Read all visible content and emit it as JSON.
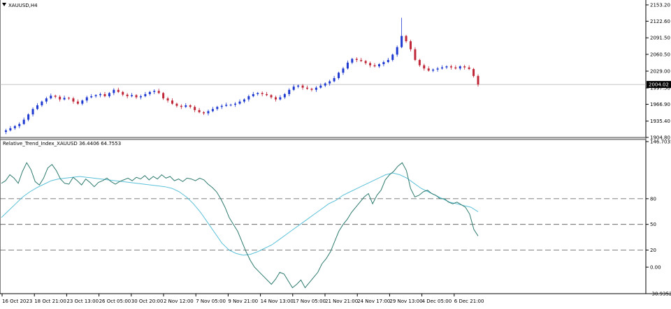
{
  "window": {
    "title": "XAUUSD,H4",
    "menu_icon": "triangle-down-icon"
  },
  "price_panel": {
    "y_ticks": [
      "2153.20",
      "2122.60",
      "2091.50",
      "2060.50",
      "2029.00",
      "1997.50",
      "1966.90",
      "1935.40",
      "1904.80"
    ],
    "current_price": "2004.02",
    "colors": {
      "bull": "#1f3ad0",
      "bear": "#c0283a",
      "wick": "#202020",
      "price_line": "#b0b0b0",
      "price_box": "#000000"
    }
  },
  "indicator_panel": {
    "label": "Relative_Trend_Index_XAUUSD 36.4406 64.7553",
    "y_ticks": [
      "146.7035",
      "80",
      "50",
      "20",
      "0.00",
      "-30.9352"
    ],
    "levels": [
      80,
      50,
      20
    ],
    "colors": {
      "rti": "#2e7a6e",
      "signal": "#5ac0d8",
      "level": "#555555"
    }
  },
  "time_axis": {
    "labels": [
      "16 Oct 2023",
      "18 Oct 21:00",
      "23 Oct 13:00",
      "26 Oct 05:00",
      "30 Oct 20:00",
      "2 Nov 12:00",
      "7 Nov 05:00",
      "9 Nov 21:00",
      "14 Nov 13:00",
      "17 Nov 05:00",
      "21 Nov 21:00",
      "24 Nov 17:00",
      "29 Nov 13:00",
      "4 Dec 05:00",
      "6 Dec 21:00"
    ]
  },
  "chart_data": [
    {
      "type": "candlestick",
      "title": "XAUUSD,H4",
      "ylim": [
        1904.8,
        2153.2
      ],
      "y_ticks": [
        2153.2,
        2122.6,
        2091.5,
        2060.5,
        2029.0,
        1997.5,
        1966.9,
        1935.4,
        1904.8
      ],
      "last_price": 2004.02,
      "x_labels": [
        "16 Oct 2023",
        "18 Oct 21:00",
        "23 Oct 13:00",
        "26 Oct 05:00",
        "30 Oct 20:00",
        "2 Nov 12:00",
        "7 Nov 05:00",
        "9 Nov 21:00",
        "14 Nov 13:00",
        "17 Nov 05:00",
        "21 Nov 21:00",
        "24 Nov 17:00",
        "29 Nov 13:00",
        "4 Dec 05:00",
        "6 Dec 21:00"
      ],
      "close_path": [
        1915,
        1918,
        1922,
        1926,
        1930,
        1938,
        1948,
        1958,
        1965,
        1972,
        1978,
        1983,
        1981,
        1976,
        1979,
        1978,
        1972,
        1968,
        1974,
        1980,
        1982,
        1984,
        1986,
        1982,
        1988,
        1994,
        1990,
        1985,
        1982,
        1984,
        1980,
        1982,
        1986,
        1990,
        1992,
        1988,
        1978,
        1974,
        1968,
        1964,
        1962,
        1965,
        1962,
        1956,
        1952,
        1950,
        1954,
        1958,
        1962,
        1964,
        1966,
        1966,
        1968,
        1972,
        1976,
        1982,
        1986,
        1988,
        1986,
        1984,
        1980,
        1976,
        1980,
        1986,
        1994,
        2000,
        2002,
        1998,
        1996,
        1994,
        1998,
        2002,
        2006,
        2010,
        2016,
        2026,
        2034,
        2045,
        2052,
        2050,
        2048,
        2044,
        2040,
        2038,
        2042,
        2046,
        2050,
        2060,
        2074,
        2095,
        2085,
        2070,
        2050,
        2040,
        2034,
        2030,
        2032,
        2034,
        2036,
        2038,
        2036,
        2034,
        2038,
        2036,
        2033,
        2020,
        2004
      ]
    },
    {
      "type": "line",
      "title": "Relative_Trend_Index_XAUUSD 36.4406 64.7553",
      "ylim": [
        -30.9352,
        146.7035
      ],
      "y_ticks": [
        146.7035,
        80,
        50,
        20,
        0.0,
        -30.9352
      ],
      "levels": [
        80,
        50,
        20
      ],
      "series": [
        {
          "name": "Relative_Trend_Index_XAUUSD",
          "last": 36.4406,
          "values": [
            98,
            101,
            108,
            104,
            98,
            112,
            122,
            114,
            100,
            96,
            104,
            116,
            120,
            113,
            103,
            98,
            97,
            105,
            101,
            96,
            103,
            99,
            94,
            99,
            101,
            104,
            100,
            97,
            100,
            102,
            104,
            101,
            105,
            103,
            107,
            102,
            106,
            103,
            108,
            104,
            106,
            101,
            103,
            100,
            104,
            103,
            101,
            104,
            102,
            97,
            93,
            88,
            80,
            70,
            58,
            50,
            42,
            30,
            18,
            8,
            0,
            -5,
            -10,
            -15,
            -20,
            -14,
            -6,
            -8,
            -16,
            -24,
            -20,
            -15,
            -24,
            -18,
            -12,
            -6,
            4,
            10,
            18,
            30,
            42,
            50,
            56,
            64,
            70,
            76,
            82,
            86,
            74,
            84,
            90,
            102,
            108,
            112,
            118,
            122,
            113,
            92,
            82,
            84,
            88,
            90,
            86,
            84,
            80,
            80,
            76,
            74,
            76,
            73,
            70,
            62,
            44,
            36.4406
          ]
        },
        {
          "name": "Signal",
          "last": 64.7553,
          "values": [
            58,
            66,
            74,
            82,
            88,
            93,
            97,
            101,
            103,
            104,
            105,
            106,
            105,
            104,
            103,
            102,
            101,
            100,
            99,
            98,
            97,
            96,
            95,
            94,
            92,
            88,
            82,
            74,
            64,
            52,
            40,
            28,
            20,
            16,
            14,
            15,
            18,
            22,
            26,
            32,
            38,
            44,
            50,
            56,
            62,
            68,
            74,
            78,
            84,
            88,
            92,
            96,
            100,
            104,
            108,
            110,
            108,
            104,
            98,
            92,
            88,
            84,
            80,
            76,
            74,
            72,
            70,
            64.7553
          ]
        }
      ]
    }
  ]
}
